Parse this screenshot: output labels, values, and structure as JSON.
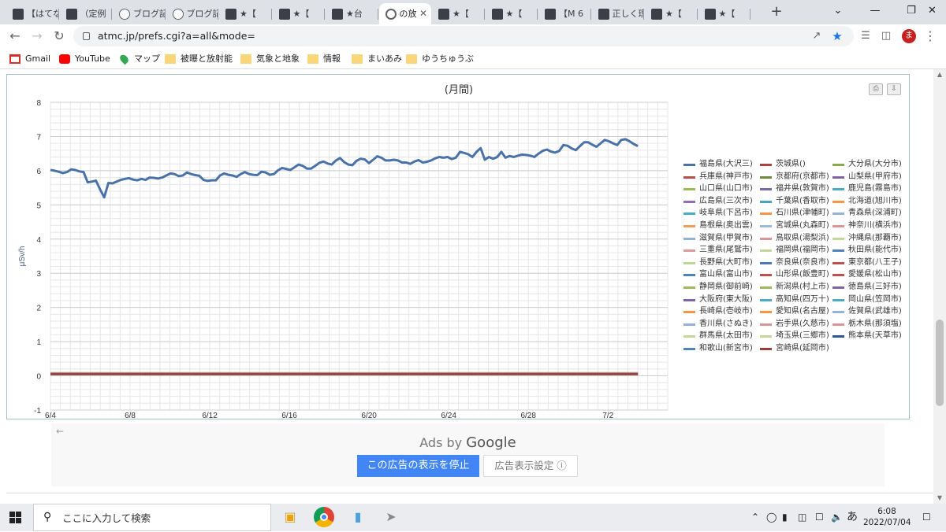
{
  "browser": {
    "tabs": [
      {
        "title": "【はてな",
        "icon": "site-icon"
      },
      {
        "title": "（定例",
        "icon": "site-icon"
      },
      {
        "title": "ブログ記",
        "icon": "info-icon"
      },
      {
        "title": "ブログ記",
        "icon": "info-icon"
      },
      {
        "title": "★【",
        "icon": "site-icon"
      },
      {
        "title": "★【",
        "icon": "site-icon"
      },
      {
        "title": "★台",
        "icon": "site-icon"
      },
      {
        "title": "の放",
        "icon": "globe-icon",
        "active": true
      },
      {
        "title": "★【",
        "icon": "site-icon"
      },
      {
        "title": "★【",
        "icon": "site-icon"
      },
      {
        "title": "【M 6",
        "icon": "site-icon"
      },
      {
        "title": "正しく理",
        "icon": "site-icon"
      },
      {
        "title": "★【",
        "icon": "site-icon"
      },
      {
        "title": "★【",
        "icon": "site-icon"
      }
    ],
    "new_tab": "+",
    "window_controls": {
      "dropdown": "⌄",
      "minimize": "—",
      "restore": "❐",
      "close": "✕"
    },
    "url": "atmc.jp/prefs.cgi?a=all&mode=",
    "avatar_letter": "ま",
    "bookmarks": [
      {
        "label": "Gmail",
        "icon": "gmail-icon"
      },
      {
        "label": "YouTube",
        "icon": "youtube-icon"
      },
      {
        "label": "マップ",
        "icon": "maps-icon"
      },
      {
        "label": "被曝と放射能",
        "icon": "folder-icon"
      },
      {
        "label": "気象と地象",
        "icon": "folder-icon"
      },
      {
        "label": "情報",
        "icon": "folder-icon"
      },
      {
        "label": "まいあみ",
        "icon": "folder-icon"
      },
      {
        "label": "ゆうちゅうぶ",
        "icon": "folder-icon"
      }
    ]
  },
  "chart_data": {
    "type": "line",
    "title": "(月間)",
    "ylabel": "μSv/h",
    "xlabel": "",
    "ylim": [
      -1,
      8
    ],
    "yticks": [
      -1,
      0,
      1,
      2,
      3,
      4,
      5,
      6,
      7,
      8
    ],
    "xticks": [
      "6/4",
      "6/8",
      "6/12",
      "6/16",
      "6/20",
      "6/24",
      "6/28",
      "7/2"
    ],
    "grid": true,
    "legend_placement": "right",
    "x_range_days": [
      "6/4",
      "7/5"
    ],
    "series": [
      {
        "name": "福島県(大沢三)",
        "color": "#4a72a8",
        "values": [
          6.02,
          6.0,
          5.97,
          5.93,
          5.96,
          6.04,
          6.02,
          5.98,
          5.96,
          5.66,
          5.68,
          5.71,
          5.45,
          5.22,
          5.64,
          5.63,
          5.68,
          5.73,
          5.76,
          5.78,
          5.74,
          5.72,
          5.76,
          5.73,
          5.8,
          5.79,
          5.77,
          5.8,
          5.86,
          5.92,
          5.9,
          5.84,
          5.86,
          5.95,
          5.9,
          5.87,
          5.85,
          5.73,
          5.7,
          5.72,
          5.72,
          5.86,
          5.92,
          5.88,
          5.86,
          5.82,
          5.9,
          5.96,
          5.9,
          5.88,
          5.87,
          5.97,
          5.95,
          5.88,
          5.9,
          6.01,
          6.08,
          6.05,
          6.02,
          6.1,
          6.18,
          6.14,
          6.06,
          6.06,
          6.14,
          6.23,
          6.27,
          6.21,
          6.18,
          6.3,
          6.37,
          6.25,
          6.18,
          6.16,
          6.29,
          6.35,
          6.33,
          6.22,
          6.32,
          6.42,
          6.38,
          6.3,
          6.3,
          6.32,
          6.3,
          6.24,
          6.24,
          6.2,
          6.27,
          6.31,
          6.24,
          6.26,
          6.3,
          6.36,
          6.4,
          6.38,
          6.4,
          6.34,
          6.38,
          6.55,
          6.52,
          6.48,
          6.4,
          6.55,
          6.66,
          6.32,
          6.4,
          6.35,
          6.4,
          6.55,
          6.38,
          6.43,
          6.4,
          6.44,
          6.47,
          6.46,
          6.44,
          6.4,
          6.5,
          6.58,
          6.62,
          6.56,
          6.53,
          6.58,
          6.75,
          6.73,
          6.65,
          6.6,
          6.72,
          6.83,
          6.83,
          6.76,
          6.7,
          6.8,
          6.9,
          6.86,
          6.8,
          6.75,
          6.9,
          6.92,
          6.86,
          6.78,
          6.72
        ]
      },
      {
        "name": "茨城県()",
        "color": "#a94442",
        "values": [
          0.06,
          0.06
        ]
      },
      {
        "name": "大分県(大分市)",
        "color": "#8aa84e",
        "values": [
          0.06,
          0.06
        ]
      },
      {
        "name": "兵庫県(神戸市)",
        "color": "#b5504d",
        "values": [
          0.07,
          0.07
        ]
      },
      {
        "name": "京都府(京都市)",
        "color": "#6e8b3d",
        "values": [
          0.07,
          0.07
        ]
      },
      {
        "name": "山梨県(甲府市)",
        "color": "#8064a2",
        "values": [
          0.05,
          0.05
        ]
      },
      {
        "name": "山口県(山口市)",
        "color": "#9bbb59",
        "values": [
          0.08,
          0.08
        ]
      },
      {
        "name": "福井県(敦賀市)",
        "color": "#7b68a8",
        "values": [
          0.06,
          0.06
        ]
      },
      {
        "name": "鹿児島(霧島市)",
        "color": "#4bacc6",
        "values": [
          0.05,
          0.05
        ]
      },
      {
        "name": "広島県(三次市)",
        "color": "#8f70b0",
        "values": [
          0.06,
          0.06
        ]
      },
      {
        "name": "千葉県(香取市)",
        "color": "#4aa4bd",
        "values": [
          0.05,
          0.05
        ]
      },
      {
        "name": "北海道(旭川市)",
        "color": "#f79646",
        "values": [
          0.04,
          0.04
        ]
      },
      {
        "name": "岐阜県(下呂市)",
        "color": "#4bacc6",
        "values": [
          0.07,
          0.07
        ]
      },
      {
        "name": "石川県(津幡町)",
        "color": "#f79646",
        "values": [
          0.06,
          0.06
        ]
      },
      {
        "name": "青森県(深浦町)",
        "color": "#95b3d7",
        "values": [
          0.05,
          0.05
        ]
      },
      {
        "name": "島根県(奥出雲)",
        "color": "#f59d56",
        "values": [
          0.08,
          0.08
        ]
      },
      {
        "name": "宮城県(丸森町)",
        "color": "#9db9da",
        "values": [
          0.06,
          0.06
        ]
      },
      {
        "name": "神奈川(横浜市)",
        "color": "#d99694",
        "values": [
          0.05,
          0.05
        ]
      },
      {
        "name": "滋賀県(甲賀市)",
        "color": "#95b3d7",
        "values": [
          0.06,
          0.06
        ]
      },
      {
        "name": "鳥取県(湯梨浜)",
        "color": "#d99694",
        "values": [
          0.06,
          0.06
        ]
      },
      {
        "name": "沖縄県(那覇市)",
        "color": "#c3d69b",
        "values": [
          0.04,
          0.04
        ]
      },
      {
        "name": "三重県(尾鷲市)",
        "color": "#dc9c9a",
        "values": [
          0.07,
          0.07
        ]
      },
      {
        "name": "福岡県(福岡市)",
        "color": "#c3d69b",
        "values": [
          0.05,
          0.05
        ]
      },
      {
        "name": "秋田県(能代市)",
        "color": "#4f81bd",
        "values": [
          0.05,
          0.05
        ]
      },
      {
        "name": "長野県(大町市)",
        "color": "#bfd695",
        "values": [
          0.06,
          0.06
        ]
      },
      {
        "name": "奈良県(奈良市)",
        "color": "#4a7ab5",
        "values": [
          0.06,
          0.06
        ]
      },
      {
        "name": "東京都(八王子)",
        "color": "#c0504d",
        "values": [
          0.06,
          0.06
        ]
      },
      {
        "name": "富山県(富山市)",
        "color": "#4f81bd",
        "values": [
          0.06,
          0.06
        ]
      },
      {
        "name": "山形県(飯豊町)",
        "color": "#c0504d",
        "values": [
          0.06,
          0.06
        ]
      },
      {
        "name": "愛媛県(松山市)",
        "color": "#c0504d",
        "values": [
          0.06,
          0.06
        ]
      },
      {
        "name": "静岡県(御前崎)",
        "color": "#9bbb59",
        "values": [
          0.05,
          0.05
        ]
      },
      {
        "name": "新潟県(村上市)",
        "color": "#9bbb59",
        "values": [
          0.06,
          0.06
        ]
      },
      {
        "name": "徳島県(三好市)",
        "color": "#8064a2",
        "values": [
          0.06,
          0.06
        ]
      },
      {
        "name": "大阪府(東大阪)",
        "color": "#8064a2",
        "values": [
          0.07,
          0.07
        ]
      },
      {
        "name": "高知県(四万十)",
        "color": "#4bacc6",
        "values": [
          0.06,
          0.06
        ]
      },
      {
        "name": "岡山県(笠岡市)",
        "color": "#4bacc6",
        "values": [
          0.07,
          0.07
        ]
      },
      {
        "name": "長崎県(壱岐市)",
        "color": "#f79646",
        "values": [
          0.06,
          0.06
        ]
      },
      {
        "name": "愛知県(名古屋)",
        "color": "#f79646",
        "values": [
          0.06,
          0.06
        ]
      },
      {
        "name": "佐賀県(武雄市)",
        "color": "#95b3d7",
        "values": [
          0.06,
          0.06
        ]
      },
      {
        "name": "香川県(さぬき)",
        "color": "#95b3d7",
        "values": [
          0.07,
          0.07
        ]
      },
      {
        "name": "岩手県(久慈市)",
        "color": "#d99694",
        "values": [
          0.05,
          0.05
        ]
      },
      {
        "name": "栃木県(那須塩)",
        "color": "#d99694",
        "values": [
          0.08,
          0.08
        ]
      },
      {
        "name": "群馬県(太田市)",
        "color": "#c3d69b",
        "values": [
          0.06,
          0.06
        ]
      },
      {
        "name": "埼玉県(三郷市)",
        "color": "#c3d69b",
        "values": [
          0.06,
          0.06
        ]
      },
      {
        "name": "熊本県(天草市)",
        "color": "#2f5597",
        "values": [
          0.05,
          0.05
        ]
      },
      {
        "name": "和歌山(新宮市)",
        "color": "#4f81bd",
        "values": [
          0.06,
          0.06
        ]
      },
      {
        "name": "宮崎県(延岡市)",
        "color": "#a33b38",
        "values": [
          0.05,
          0.05
        ]
      }
    ]
  },
  "ads": {
    "ads_by": "Ads by",
    "google": "Google",
    "stop_button": "この広告の表示を停止",
    "settings_button": "広告表示設定 ⓘ",
    "back_arrow": "←"
  },
  "taskbar": {
    "search_placeholder": "ここに入力して検索",
    "ime": "あ",
    "time": "6:08",
    "date": "2022/07/04"
  }
}
